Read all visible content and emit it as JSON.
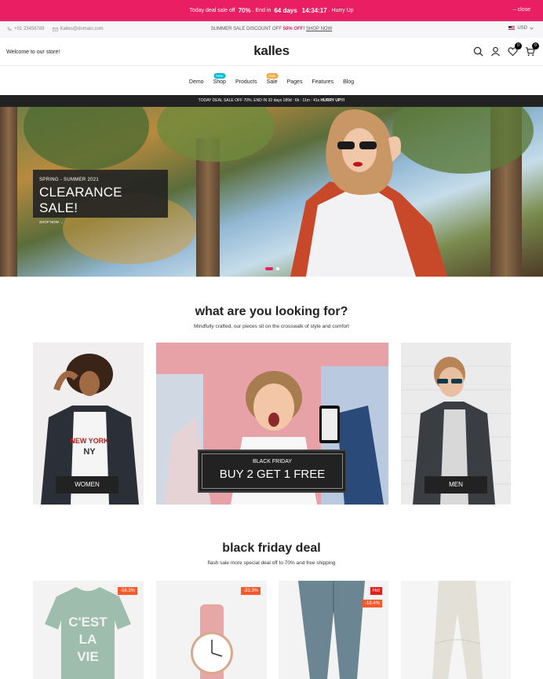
{
  "promo": {
    "text_before": "Today deal sale off",
    "percent": "70%",
    "text_mid": ". End in",
    "days": "64 days",
    "time": "14:34:17",
    "text_after": ". Hurry Up",
    "close": "close"
  },
  "info_bar": {
    "phone": "+01 23456789",
    "email": "Kalles@domain.com",
    "center_before": "SUMMER SALE DISCOUNT OFF",
    "center_percent": "50% OFF!",
    "center_link": "SHOP NOW",
    "currency": "USD"
  },
  "header": {
    "welcome": "Welcome to our store!",
    "logo": "kalles",
    "wishlist_count": "0",
    "cart_count": "0"
  },
  "nav": {
    "items": [
      {
        "label": "Demo"
      },
      {
        "label": "Shop",
        "badge": "New",
        "badge_color": "#01bad4"
      },
      {
        "label": "Products"
      },
      {
        "label": "Sale",
        "badge": "Sale",
        "badge_color": "#f8a63f"
      },
      {
        "label": "Pages"
      },
      {
        "label": "Features"
      },
      {
        "label": "Blog"
      }
    ]
  },
  "deal_bar": {
    "text": "TODAY DEAL SALE OFF 70%. END IN 32 days 189d : 6h : 11m : 41s",
    "cta": "HURRY UP!!!"
  },
  "hero": {
    "subtitle": "SPRING - SUMMER 2021",
    "title": "CLEARANCE SALE!",
    "link": "SHOP NOW →"
  },
  "categories": {
    "title": "what are you looking for?",
    "subtitle": "Mindfully crafted, our pieces sit on the crosswalk of style and comfort",
    "women": "WOMEN",
    "bf_small": "BLACK FRIDAY",
    "bf_big": "BUY 2 GET 1 FREE",
    "men": "MEN"
  },
  "deals": {
    "title": "black friday deal",
    "subtitle": "flash sale more special deal off to 70% and free shipping",
    "products": [
      {
        "tags": [
          "-58.3%"
        ],
        "tee_text": "C'EST LA VIE"
      },
      {
        "tags": [
          "-33.3%"
        ]
      },
      {
        "tags": [
          "Hot",
          "-18.4%"
        ]
      },
      {
        "tags": []
      }
    ]
  },
  "colors": {
    "accent": "#e91e63",
    "dark": "#222222",
    "sale_tag": "#f5582a",
    "hot_tag": "#e0201f"
  }
}
